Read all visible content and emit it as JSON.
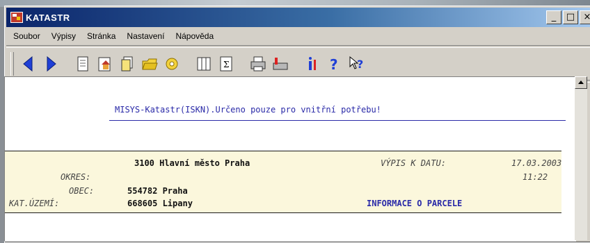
{
  "window": {
    "title": "KATASTR",
    "controls": [
      "_",
      "□",
      "×"
    ]
  },
  "menu": [
    "Soubor",
    "Výpisy",
    "Stránka",
    "Nastavení",
    "Nápověda"
  ],
  "toolbar": {
    "icons": [
      "back-arrow-icon",
      "forward-arrow-icon",
      "document-icon",
      "house-document-icon",
      "document-stack-icon",
      "folder-icon",
      "printer-gear-icon",
      "columns-icon",
      "sum-icon",
      "printer-icon",
      "scanner-icon",
      "info-icon",
      "help-icon",
      "context-help-icon"
    ]
  },
  "content": {
    "banner": "MISYS-Katastr(ISKN).Určeno pouze pro vnitřní potřebu!",
    "header": {
      "region": "3100 Hlavní město Praha",
      "date_label": "VÝPIS K DATU:",
      "date_value": "17.03.2003",
      "time": "11:22",
      "okres_label": "OKRES:",
      "obec_label": "OBEC:",
      "obec_value": "554782 Praha",
      "kat_label": "KAT.ÚZEMÍ:",
      "kat_value": "668605 Lipany",
      "info_title": "INFORMACE O PARCELE"
    }
  }
}
